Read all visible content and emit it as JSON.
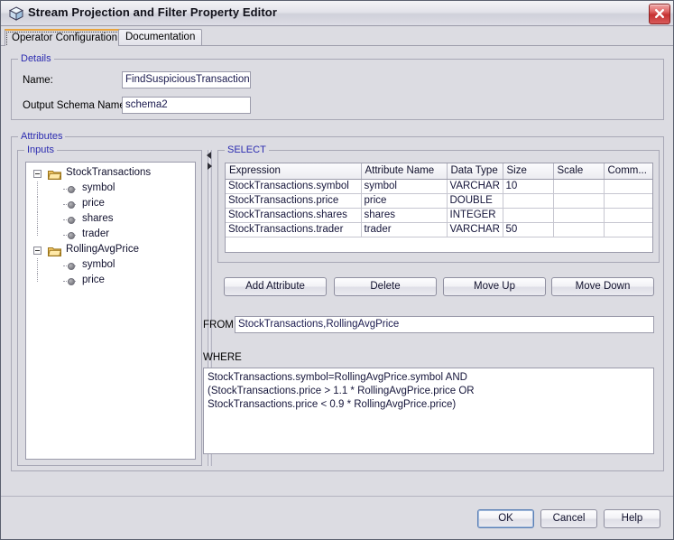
{
  "window": {
    "title": "Stream Projection and Filter Property Editor",
    "icon": "cube-icon",
    "close_label": "close-icon"
  },
  "tabs": [
    {
      "label": "Operator Configuration",
      "active": true
    },
    {
      "label": "Documentation",
      "active": false
    }
  ],
  "details": {
    "legend": "Details",
    "name_label": "Name:",
    "name_value": "FindSuspiciousTransactions",
    "schema_label": "Output Schema Name:",
    "schema_value": "schema2"
  },
  "attributes": {
    "legend": "Attributes"
  },
  "inputs": {
    "legend": "Inputs",
    "tree": [
      {
        "label": "StockTransactions",
        "type": "folder",
        "expanded": true
      },
      {
        "label": "symbol",
        "type": "leaf"
      },
      {
        "label": "price",
        "type": "leaf"
      },
      {
        "label": "shares",
        "type": "leaf"
      },
      {
        "label": "trader",
        "type": "leaf"
      },
      {
        "label": "RollingAvgPrice",
        "type": "folder",
        "expanded": true
      },
      {
        "label": "symbol",
        "type": "leaf"
      },
      {
        "label": "price",
        "type": "leaf"
      }
    ]
  },
  "select": {
    "legend": "SELECT",
    "columns": [
      "Expression",
      "Attribute Name",
      "Data Type",
      "Size",
      "Scale",
      "Comm..."
    ],
    "rows": [
      [
        "StockTransactions.symbol",
        "symbol",
        "VARCHAR",
        "10",
        "",
        ""
      ],
      [
        "StockTransactions.price",
        "price",
        "DOUBLE",
        "",
        "",
        ""
      ],
      [
        "StockTransactions.shares",
        "shares",
        "INTEGER",
        "",
        "",
        ""
      ],
      [
        "StockTransactions.trader",
        "trader",
        "VARCHAR",
        "50",
        "",
        ""
      ]
    ],
    "buttons": {
      "add": "Add Attribute",
      "delete": "Delete",
      "move_up": "Move Up",
      "move_down": "Move Down"
    }
  },
  "from": {
    "label": "FROM",
    "value": "StockTransactions,RollingAvgPrice"
  },
  "where": {
    "label": "WHERE",
    "value": "StockTransactions.symbol=RollingAvgPrice.symbol AND\n(StockTransactions.price > 1.1 * RollingAvgPrice.price OR\nStockTransactions.price < 0.9 * RollingAvgPrice.price)"
  },
  "footer": {
    "ok": "OK",
    "cancel": "Cancel",
    "help": "Help"
  },
  "colors": {
    "legend_text": "#2b2bb0",
    "active_tab_accent": "#e8a33d",
    "close_button": "#c63232",
    "panel_bg": "#dcdce2",
    "field_text": "#15153a"
  }
}
